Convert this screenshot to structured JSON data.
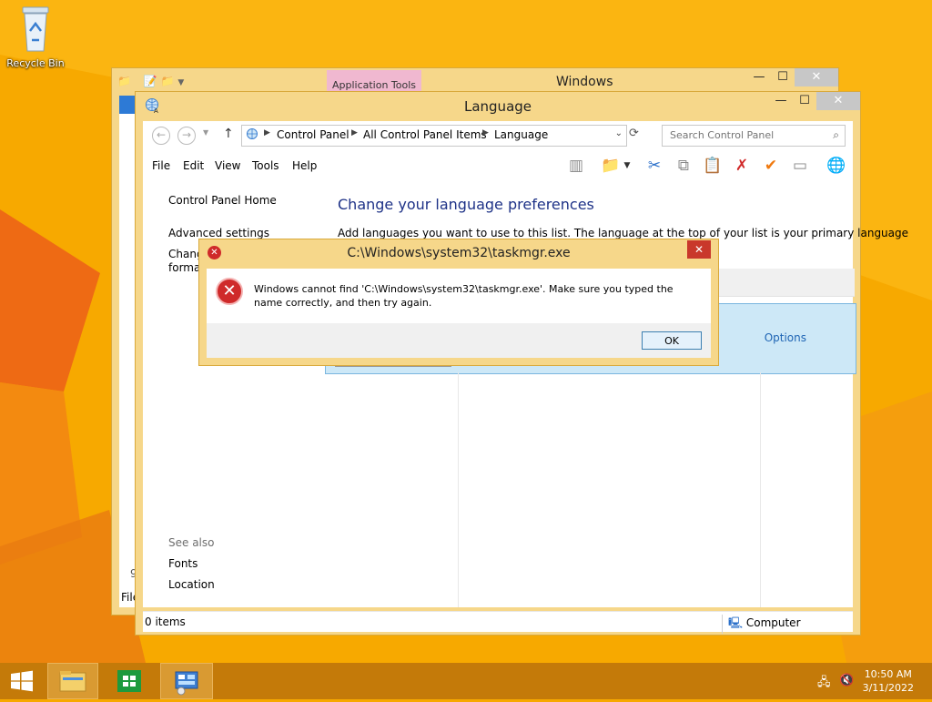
{
  "desktop": {
    "icons": [
      {
        "label": "Recycle Bin",
        "icon": "recycle-bin-icon"
      }
    ]
  },
  "explorer_back": {
    "ribbon_context_tab": "Application Tools",
    "title": "Windows",
    "file_menu_label": "File",
    "clipped_text": "9"
  },
  "language_window": {
    "title": "Language",
    "address": {
      "crumbs": [
        "Control Panel",
        "All Control Panel Items",
        "Language"
      ]
    },
    "search": {
      "placeholder": "Search Control Panel"
    },
    "menu": [
      "File",
      "Edit",
      "View",
      "Tools",
      "Help"
    ],
    "toolbar_icons": [
      "layout-icon",
      "folder-options-icon",
      "cut-icon",
      "copy-icon",
      "paste-icon",
      "delete-icon",
      "check-icon",
      "properties-icon",
      "globe-icon"
    ],
    "left_pane": {
      "links": [
        "Control Panel Home",
        "Advanced settings",
        "Chang",
        "forma"
      ],
      "see_also_label": "See also",
      "see_also_links": [
        "Fonts",
        "Location"
      ]
    },
    "main": {
      "heading": "Change your language preferences",
      "description": "Add languages you want to use to this list. The language at the top of your list is your primary language",
      "options_link": "Options"
    },
    "status": {
      "items": "0 items",
      "zone": "Computer"
    }
  },
  "dialog": {
    "title": "C:\\Windows\\system32\\taskmgr.exe",
    "message": "Windows cannot find 'C:\\Windows\\system32\\taskmgr.exe'. Make sure you typed the name correctly, and then try again.",
    "ok_label": "OK",
    "close_glyph": "✕",
    "error_glyph": "✕"
  },
  "taskbar": {
    "time": "10:50 AM",
    "date": "3/11/2022"
  }
}
